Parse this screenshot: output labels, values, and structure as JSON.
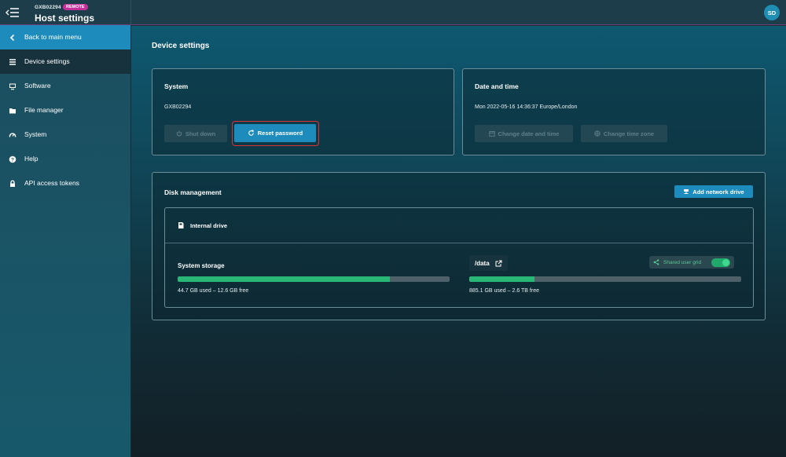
{
  "header": {
    "host_id": "GXB02294",
    "badge": "REMOTE",
    "title": "Host settings",
    "avatar_initials": "SD"
  },
  "sidebar": {
    "items": [
      {
        "label": "Back to main menu",
        "icon": "chevron-left-icon"
      },
      {
        "label": "Device settings",
        "icon": "list-icon"
      },
      {
        "label": "Software",
        "icon": "monitor-icon"
      },
      {
        "label": "File manager",
        "icon": "folder-icon"
      },
      {
        "label": "System",
        "icon": "gauge-icon"
      },
      {
        "label": "Help",
        "icon": "help-icon"
      },
      {
        "label": "API access tokens",
        "icon": "lock-icon"
      }
    ]
  },
  "main": {
    "page_title": "Device settings",
    "system": {
      "title": "System",
      "host": "GXB02294",
      "shutdown_label": "Shut down",
      "reset_label": "Reset password"
    },
    "datetime": {
      "title": "Date and time",
      "value": "Mon 2022-05-16 14:36:37 Europe/London",
      "change_date_label": "Change date and time",
      "change_zone_label": "Change time zone"
    },
    "disk": {
      "title": "Disk management",
      "add_drive_label": "Add network drive",
      "internal_drive_label": "Internal drive",
      "system_storage": {
        "label": "System storage",
        "usage_text": "44.7 GB used – 12.6 GB free",
        "used_fraction": 0.78
      },
      "data_volume": {
        "path": "/data",
        "usage_text": "885.1 GB used – 2.6 TB free",
        "used_fraction": 0.24,
        "shared_label": "Shared user grid",
        "shared_enabled": true
      }
    }
  },
  "colors": {
    "accent": "#1d8cbc",
    "success": "#29b776",
    "highlight": "#e0303a",
    "badge": "#c62f9a"
  }
}
